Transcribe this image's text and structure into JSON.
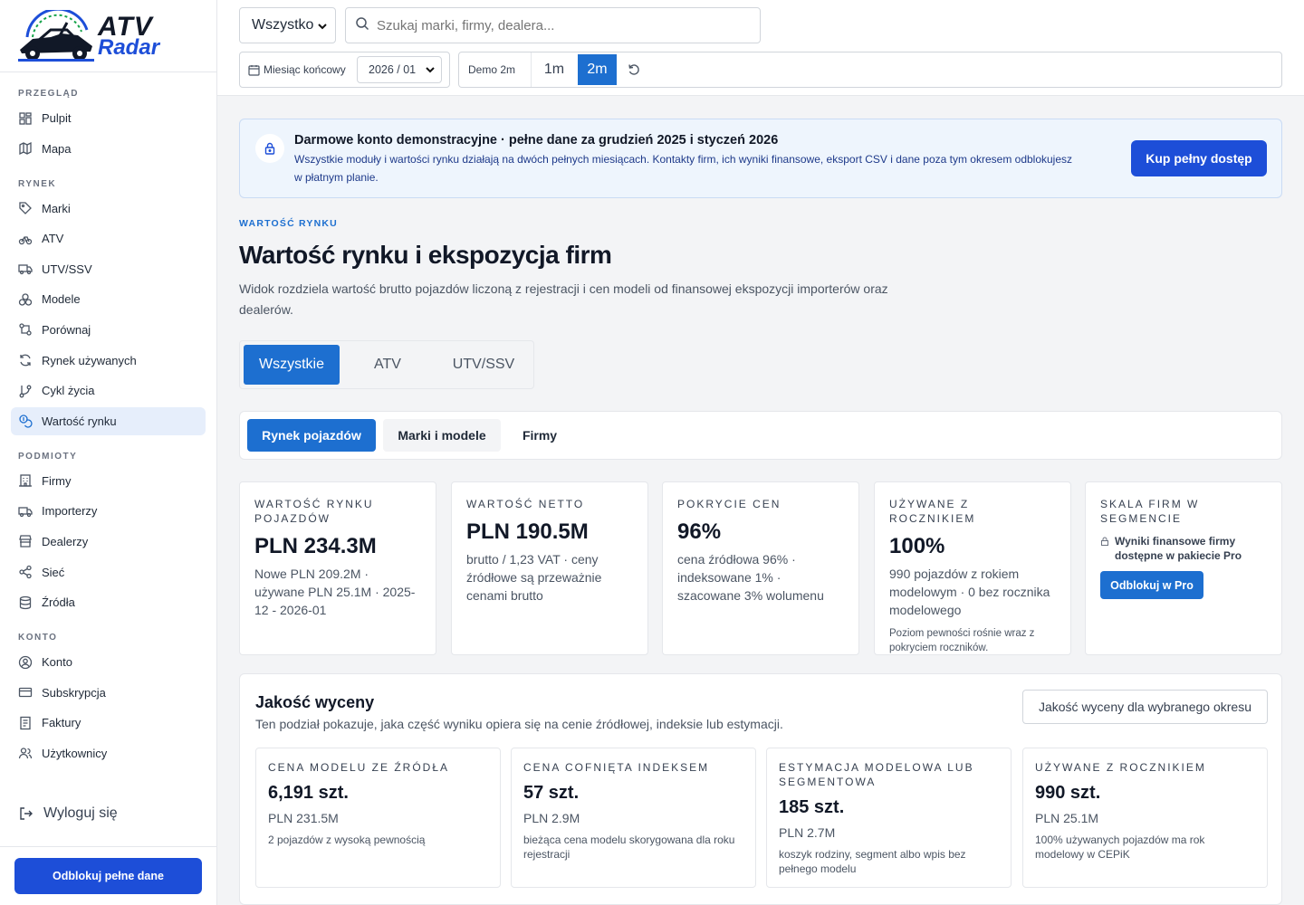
{
  "brand": {
    "line1": "ATV",
    "line2": "Radar"
  },
  "sidebar": {
    "sections": [
      {
        "title": "PRZEGLĄD",
        "items": [
          {
            "label": "Pulpit",
            "icon": "grid-icon"
          },
          {
            "label": "Mapa",
            "icon": "map-icon"
          }
        ]
      },
      {
        "title": "RYNEK",
        "items": [
          {
            "label": "Marki",
            "icon": "tag-icon"
          },
          {
            "label": "ATV",
            "icon": "bike-icon"
          },
          {
            "label": "UTV/SSV",
            "icon": "truck-icon"
          },
          {
            "label": "Modele",
            "icon": "boxes-icon"
          },
          {
            "label": "Porównaj",
            "icon": "compare-icon"
          },
          {
            "label": "Rynek używanych",
            "icon": "refresh-icon"
          },
          {
            "label": "Cykl życia",
            "icon": "git-branch-icon"
          },
          {
            "label": "Wartość rynku",
            "icon": "coins-icon",
            "active": true
          }
        ]
      },
      {
        "title": "PODMIOTY",
        "items": [
          {
            "label": "Firmy",
            "icon": "building-icon"
          },
          {
            "label": "Importerzy",
            "icon": "truck-icon"
          },
          {
            "label": "Dealerzy",
            "icon": "store-icon"
          },
          {
            "label": "Sieć",
            "icon": "share-icon"
          },
          {
            "label": "Źródła",
            "icon": "database-icon"
          }
        ]
      },
      {
        "title": "KONTO",
        "items": [
          {
            "label": "Konto",
            "icon": "user-circle-icon"
          },
          {
            "label": "Subskrypcja",
            "icon": "credit-card-icon"
          },
          {
            "label": "Faktury",
            "icon": "receipt-icon"
          },
          {
            "label": "Użytkownicy",
            "icon": "users-icon"
          }
        ]
      }
    ],
    "logout": "Wyloguj się",
    "unlock": "Odblokuj pełne dane"
  },
  "topbar": {
    "filter_value": "Wszystko",
    "search_placeholder": "Szukaj marki, firmy, dealera...",
    "month_label": "Miesiąc końcowy",
    "month_value": "2026 / 01",
    "demo_label": "Demo 2m",
    "range_options": [
      "1m",
      "2m"
    ],
    "range_selected": "2m"
  },
  "banner": {
    "title": "Darmowe konto demonstracyjne · pełne dane za grudzień 2025 i styczeń 2026",
    "text": "Wszystkie moduły i wartości rynku działają na dwóch pełnych miesiącach. Kontakty firm, ich wyniki finansowe, eksport CSV i dane poza tym okresem odblokujesz w płatnym planie.",
    "button": "Kup pełny dostęp"
  },
  "page": {
    "eyebrow": "WARTOŚĆ RYNKU",
    "title": "Wartość rynku i ekspozycja firm",
    "description": "Widok rozdziela wartość brutto pojazdów liczoną z rejestracji i cen modeli od finansowej ekspozycji importerów oraz dealerów."
  },
  "vehicle_tabs": [
    "Wszystkie",
    "ATV",
    "UTV/SSV"
  ],
  "view_tabs": [
    "Rynek pojazdów",
    "Marki i modele",
    "Firmy"
  ],
  "kpis": [
    {
      "label": "Wartość rynku pojazdów",
      "value": "PLN 234.3M",
      "sub": "Nowe PLN 209.2M · używane PLN 25.1M · 2025-12 - 2026-01"
    },
    {
      "label": "Wartość netto",
      "value": "PLN 190.5M",
      "sub": "brutto / 1,23 VAT · ceny źródłowe są przeważnie cenami brutto"
    },
    {
      "label": "Pokrycie cen",
      "value": "96%",
      "sub": "cena źródłowa 96% · indeksowane 1% · szacowane 3% wolumenu"
    },
    {
      "label": "Używane z rocznikiem",
      "value": "100%",
      "sub": "990 pojazdów z rokiem modelowym · 0 bez rocznika modelowego",
      "note": "Poziom pewności rośnie wraz z pokryciem roczników."
    },
    {
      "label": "Skala firm w segmencie",
      "lock_text": "Wyniki finansowe firmy dostępne w pakiecie Pro",
      "button": "Odblokuj w Pro"
    }
  ],
  "quality": {
    "title": "Jakość wyceny",
    "description": "Ten podział pokazuje, jaka część wyniku opiera się na cenie źródłowej, indeksie lub estymacji.",
    "period_label": "Jakość wyceny dla wybranego okresu",
    "cards": [
      {
        "label": "Cena modelu ze źródła",
        "value": "6,191 szt.",
        "pln": "PLN 231.5M",
        "note": "2 pojazdów z wysoką pewnością"
      },
      {
        "label": "Cena cofnięta indeksem",
        "value": "57 szt.",
        "pln": "PLN 2.9M",
        "note": "bieżąca cena modelu skorygowana dla roku rejestracji"
      },
      {
        "label": "Estymacja modelowa lub segmentowa",
        "value": "185 szt.",
        "pln": "PLN 2.7M",
        "note": "koszyk rodziny, segment albo wpis bez pełnego modelu"
      },
      {
        "label": "Używane z rocznikiem",
        "value": "990 szt.",
        "pln": "PLN 25.1M",
        "note": "100% używanych pojazdów ma rok modelowy w CEPiK"
      }
    ]
  },
  "colors": {
    "primary": "#1d4ed8",
    "accent": "#1d6fd0",
    "banner_bg": "#eef5fd"
  }
}
